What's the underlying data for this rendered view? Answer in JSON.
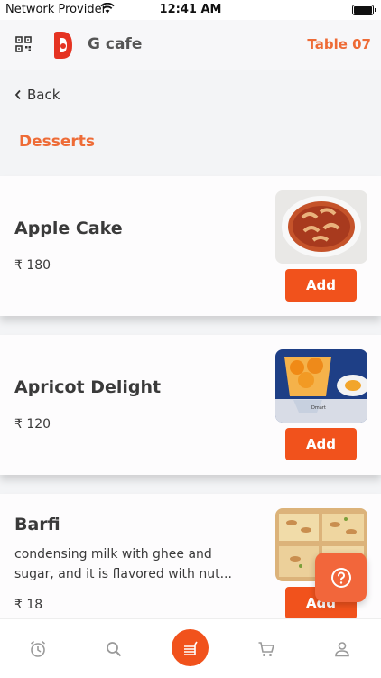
{
  "status_bar": {
    "carrier": "Network Provider",
    "time": "12:41 AM"
  },
  "header": {
    "cafe_name": "G cafe",
    "table": "Table 07"
  },
  "nav": {
    "back_label": "Back",
    "category": "Desserts"
  },
  "items": [
    {
      "name": "Apple Cake",
      "description": "",
      "price": "₹ 180",
      "add_label": "Add"
    },
    {
      "name": "Apricot Delight",
      "description": "",
      "price": "₹ 120",
      "add_label": "Add"
    },
    {
      "name": "Barfi",
      "description": "condensing milk with ghee and sugar, and it is flavored with nut...",
      "price": "₹ 18",
      "add_label": "Add"
    }
  ],
  "colors": {
    "accent": "#f1521c",
    "header_accent": "#ee6b36"
  },
  "bottom_nav": [
    "clock-icon",
    "search-icon",
    "menu-icon",
    "cart-icon",
    "profile-icon"
  ]
}
